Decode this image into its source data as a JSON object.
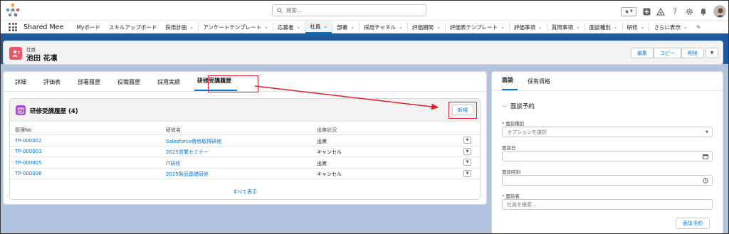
{
  "header": {
    "search_placeholder": "検索..."
  },
  "nav": {
    "app_name": "Shared Mee",
    "items": [
      {
        "label": "Myボード",
        "chevron": false
      },
      {
        "label": "スキルアップボード",
        "chevron": false
      },
      {
        "label": "採用計画",
        "chevron": true
      },
      {
        "label": "アンケートテンプレート",
        "chevron": true
      },
      {
        "label": "応募者",
        "chevron": true
      },
      {
        "label": "社員",
        "chevron": true,
        "active": true
      },
      {
        "label": "部署",
        "chevron": true
      },
      {
        "label": "採用チャネル",
        "chevron": true
      },
      {
        "label": "評価期間",
        "chevron": true
      },
      {
        "label": "評価表テンプレート",
        "chevron": true
      },
      {
        "label": "評価事項",
        "chevron": true
      },
      {
        "label": "質問事項",
        "chevron": true
      },
      {
        "label": "面談種別",
        "chevron": true
      },
      {
        "label": "研修",
        "chevron": true
      },
      {
        "label": "さらに表示",
        "chevron": true
      }
    ]
  },
  "record": {
    "type_label": "社員",
    "name": "池田 花凛",
    "actions": [
      "編集",
      "コピー",
      "削除"
    ]
  },
  "tabs": [
    "詳細",
    "評価表",
    "部署履歴",
    "役職履歴",
    "採用実績",
    "研修受講履歴"
  ],
  "related_list": {
    "title": "研修受講履歴 (4)",
    "new_button": "新規",
    "columns": [
      "管理No",
      "研修名",
      "出席状況"
    ],
    "rows": [
      {
        "no": "TP-000002",
        "name": "Salesforce資格取得研修",
        "status": "出席"
      },
      {
        "no": "TP-000003",
        "name": "2025営業セミナー",
        "status": "キャンセル"
      },
      {
        "no": "TP-000005",
        "name": "IT研修",
        "status": "出席"
      },
      {
        "no": "TP-000006",
        "name": "2025製品基礎研修",
        "status": "キャンセル"
      }
    ],
    "show_all": "すべて表示"
  },
  "right_panel": {
    "tabs": [
      "面談",
      "保有資格"
    ],
    "section_title": "面談予約",
    "fields": {
      "type_label": "面談種別",
      "type_placeholder": "オプションを選択",
      "date_label": "面談日",
      "time_label": "面談時刻",
      "interviewer_label": "面談者",
      "interviewer_placeholder": "社員を検索..."
    },
    "submit": "面談予約"
  },
  "colors": {
    "brand": "#0176d3",
    "nav_bar": "#1b5fa8",
    "annotation": "#e0202a",
    "record_icon": "#e8576b",
    "list_icon": "#a94fd1"
  }
}
